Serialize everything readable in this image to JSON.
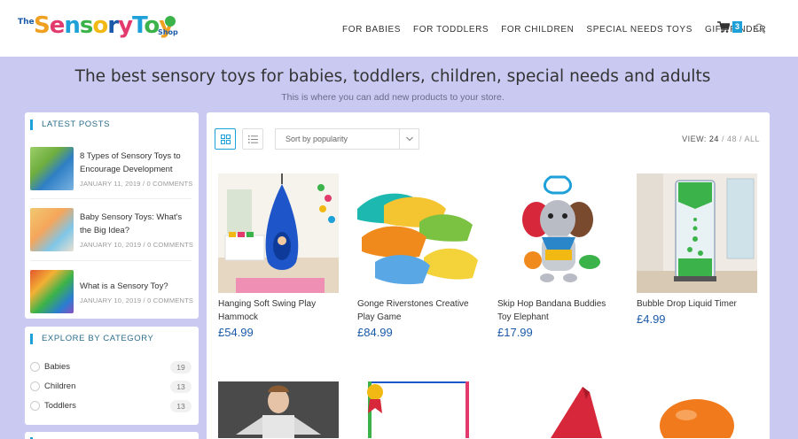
{
  "brand": {
    "the": "The",
    "name": "SensoryToy",
    "shop": "Shop"
  },
  "nav": [
    "FOR BABIES",
    "FOR TODDLERS",
    "FOR CHILDREN",
    "SPECIAL NEEDS TOYS",
    "GIFT FINDER"
  ],
  "cart": {
    "count": "3",
    "icon": "cart-icon"
  },
  "hero": {
    "title": "The best sensory toys for babies, toddlers, children, special needs and adults",
    "subtitle": "This is where you can add new products to your store."
  },
  "latest_posts": {
    "title": "LATEST POSTS",
    "posts": [
      {
        "title": "8 Types of Sensory Toys to Encourage Development",
        "meta": "JANUARY 11, 2019 / 0 COMMENTS"
      },
      {
        "title": "Baby Sensory Toys: What's the Big Idea?",
        "meta": "JANUARY 10, 2019 / 0 COMMENTS"
      },
      {
        "title": "What is a Sensory Toy?",
        "meta": "JANUARY 10, 2019 / 0 COMMENTS"
      }
    ]
  },
  "categories": {
    "title": "EXPLORE BY CATEGORY",
    "items": [
      {
        "label": "Babies",
        "count": "19"
      },
      {
        "label": "Children",
        "count": "13"
      },
      {
        "label": "Toddlers",
        "count": "13"
      }
    ]
  },
  "toolbar": {
    "sort": "Sort by popularity",
    "view_label": "VIEW:",
    "view_24": "24",
    "view_sep1": " / ",
    "view_48": "48",
    "view_sep2": " / ",
    "view_all": "ALL"
  },
  "products": [
    {
      "name": "Hanging Soft Swing Play Hammock",
      "price": "£54.99"
    },
    {
      "name": "Gonge Riverstones Creative Play Game",
      "price": "£84.99"
    },
    {
      "name": "Skip Hop Bandana Buddies Toy Elephant",
      "price": "£17.99"
    },
    {
      "name": "Bubble Drop Liquid Timer",
      "price": "£4.99"
    }
  ],
  "colors": {
    "accent": "#1ea0d8",
    "price": "#1a5aa8",
    "background": "#c9c9f1"
  }
}
